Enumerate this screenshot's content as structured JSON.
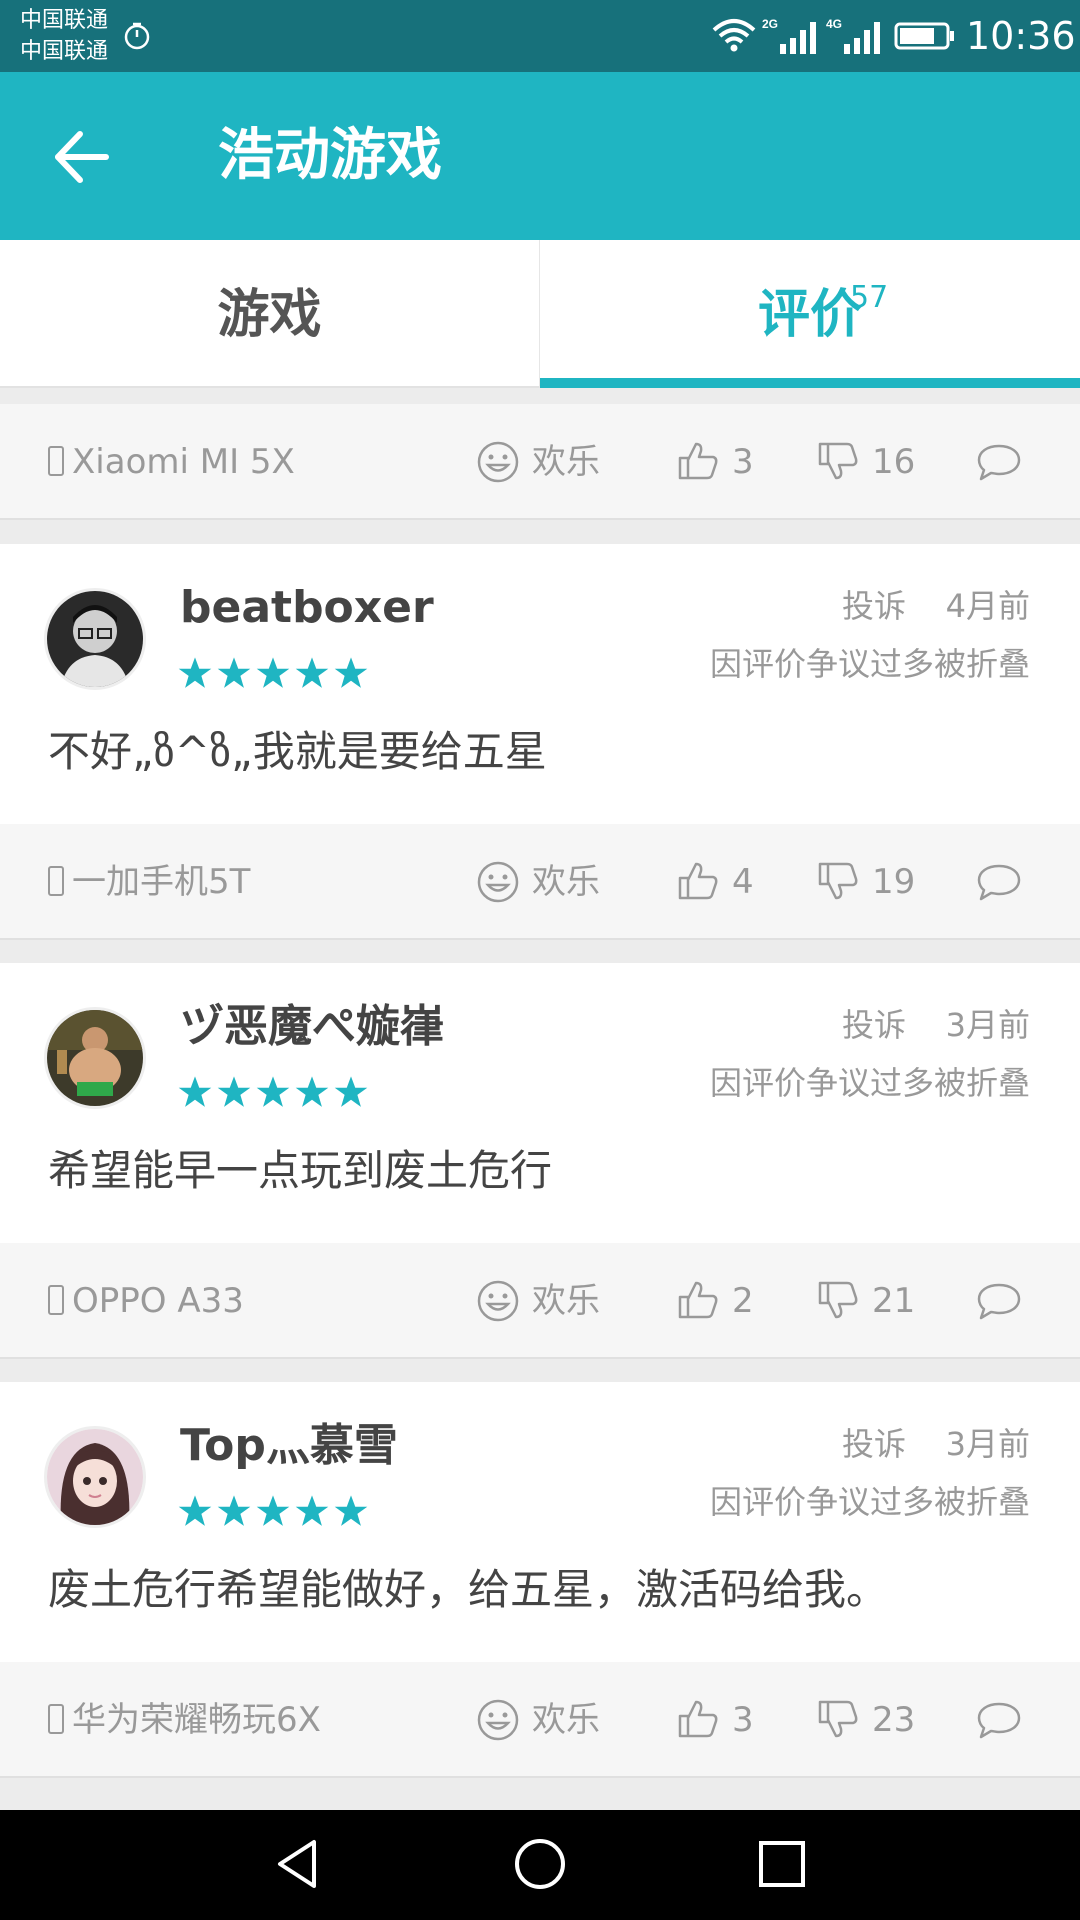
{
  "status_bar": {
    "carrier_1": "中国联通",
    "carrier_2": "中国联通",
    "network_1": "2G",
    "network_2": "4G",
    "time": "10:36"
  },
  "app_bar": {
    "title": "浩动游戏",
    "back_icon": "arrow-left-icon"
  },
  "tabs": [
    {
      "label": "游戏",
      "active": false
    },
    {
      "label": "评价",
      "count": "57",
      "active": true
    }
  ],
  "colors": {
    "accent": "#1fb5c2",
    "status_bar": "#17717b",
    "star": "#1fb5c2"
  },
  "top_footer": {
    "device": "Xiaomi MI 5X",
    "mood": "欢乐",
    "likes": "3",
    "dislikes": "16"
  },
  "reviews": [
    {
      "username": "beatboxer",
      "rating": 5,
      "report": "投诉",
      "time": "4月前",
      "folded_notice": "因评价争议过多被折叠",
      "text": "不好„ზ^ზ„我就是要给五星",
      "device": "一加手机5T",
      "mood": "欢乐",
      "likes": "4",
      "dislikes": "19"
    },
    {
      "username": "ヅ恶魔ぺ嫙嵂",
      "rating": 5,
      "report": "投诉",
      "time": "3月前",
      "folded_notice": "因评价争议过多被折叠",
      "text": "希望能早一点玩到废土危行",
      "device": "OPPO A33",
      "mood": "欢乐",
      "likes": "2",
      "dislikes": "21"
    },
    {
      "username": "Top灬慕雪",
      "rating": 5,
      "report": "投诉",
      "time": "3月前",
      "folded_notice": "因评价争议过多被折叠",
      "text": "废土危行希望能做好，给五星，激活码给我。",
      "device": "华为荣耀畅玩6X",
      "mood": "欢乐",
      "likes": "3",
      "dislikes": "23"
    }
  ],
  "nav_bar": {
    "back_icon": "triangle-back-icon",
    "home_icon": "circle-home-icon",
    "recent_icon": "square-recent-icon"
  }
}
